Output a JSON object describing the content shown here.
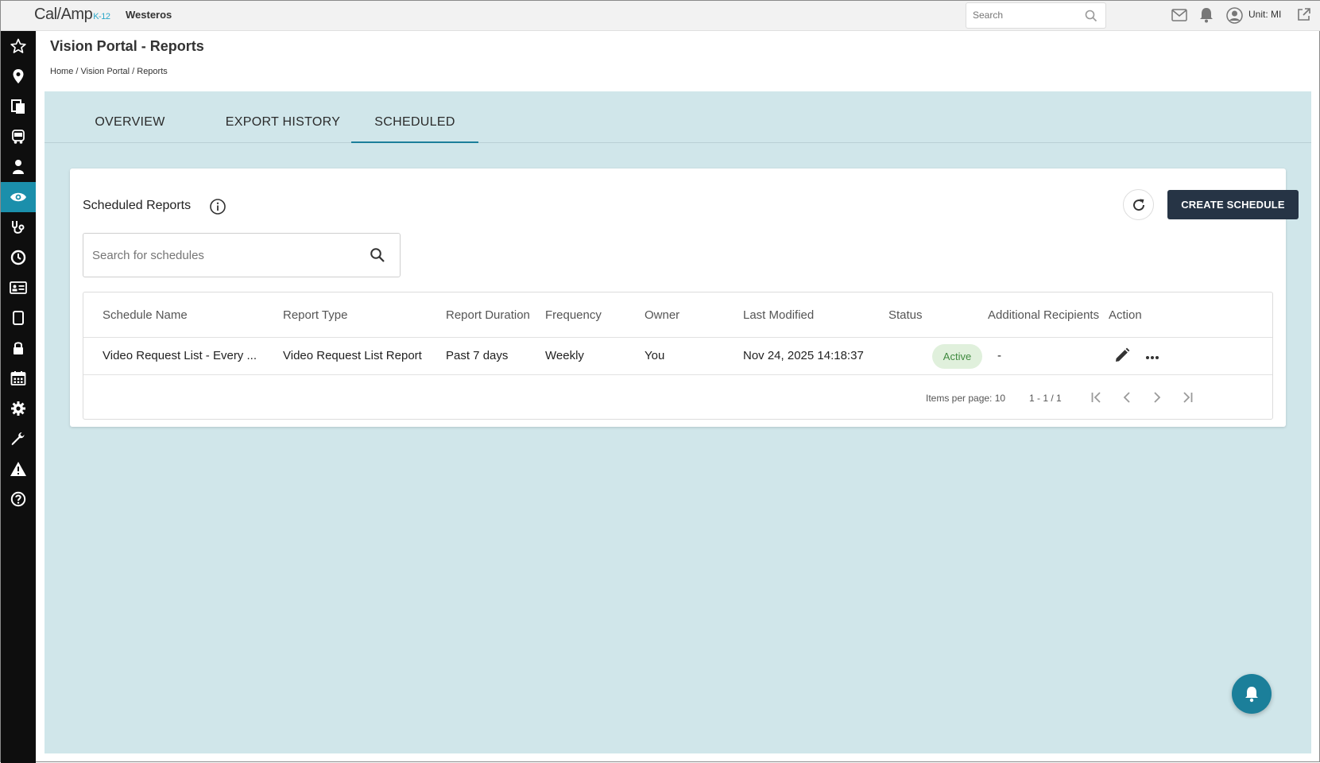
{
  "topbar": {
    "logo_main": "Cal/Amp",
    "logo_sub": "K-12",
    "org_name": "Westeros",
    "search_placeholder": "Search",
    "unit_label": "Unit: MI"
  },
  "sidebar": {
    "items": [
      {
        "icon": "star-icon"
      },
      {
        "icon": "map-pin-icon"
      },
      {
        "icon": "documents-icon"
      },
      {
        "icon": "bus-icon"
      },
      {
        "icon": "student-icon"
      },
      {
        "icon": "eye-icon",
        "active": true
      },
      {
        "icon": "stethoscope-icon"
      },
      {
        "icon": "clock-icon"
      },
      {
        "icon": "id-card-icon"
      },
      {
        "icon": "tablet-icon"
      },
      {
        "icon": "lock-icon"
      },
      {
        "icon": "calendar-icon"
      },
      {
        "icon": "gear-icon"
      },
      {
        "icon": "wrench-icon"
      },
      {
        "icon": "warning-icon"
      },
      {
        "icon": "help-icon"
      }
    ],
    "active_color": "#1b8fab"
  },
  "header": {
    "title": "Vision Portal - Reports",
    "breadcrumb": [
      "Home",
      "Vision Portal",
      "Reports"
    ],
    "breadcrumb_sep": " / "
  },
  "tabs": [
    {
      "label": "OVERVIEW"
    },
    {
      "label": "EXPORT HISTORY"
    },
    {
      "label": "SCHEDULED",
      "active": true
    }
  ],
  "card": {
    "title": "Scheduled Reports",
    "create_label": "CREATE SCHEDULE",
    "search_placeholder": "Search for schedules"
  },
  "table": {
    "columns": [
      "Schedule Name",
      "Report Type",
      "Report Duration",
      "Frequency",
      "Owner",
      "Last Modified",
      "Status",
      "Additional Recipients",
      "Action"
    ],
    "rows": [
      {
        "schedule_name": "Video Request List - Every ...",
        "report_type": "Video Request List Report",
        "report_duration": "Past 7 days",
        "frequency": "Weekly",
        "owner": "You",
        "last_modified": "Nov 24, 2025 14:18:37",
        "status": "Active",
        "additional_recipients": "-"
      }
    ],
    "items_per_page_label": "Items per page: 10",
    "range_label": "1 - 1 / 1"
  },
  "colors": {
    "content_bg": "#d0e6ea",
    "primary_dark": "#263445",
    "accent": "#1b7f9a",
    "status_active_bg": "#e0f0dc",
    "status_active_text": "#3f8a3f"
  }
}
